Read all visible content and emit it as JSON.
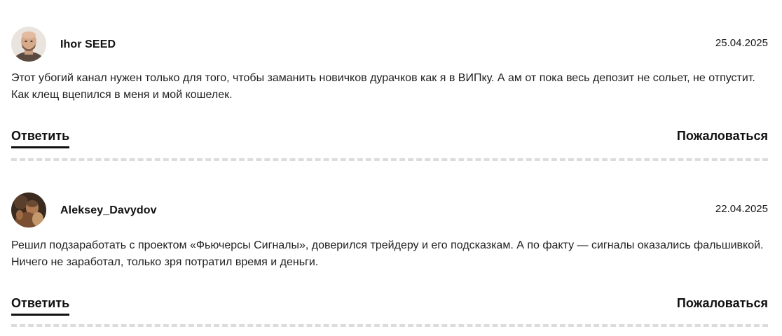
{
  "comments": [
    {
      "author": "Ihor SEED",
      "date": "25.04.2025",
      "text": "Этот убогий канал нужен только для того, чтобы заманить новичков дурачков как я в ВИПку. А ам от пока весь депозит не сольет, не отпустит. Как клещ вцепился в меня и мой кошелек.",
      "reply_label": "Ответить",
      "report_label": "Пожаловаться",
      "avatar_icon": "user-photo-bald-man"
    },
    {
      "author": "Aleksey_Davydov",
      "date": "22.04.2025",
      "text": "Решил подзаработать с проектом «Фьючерсы Сигналы», доверился трейдеру и его подсказкам. А по факту — сигналы оказались фальшивкой. Ничего не заработал, только зря потратил время и деньги.",
      "reply_label": "Ответить",
      "report_label": "Пожаловаться",
      "avatar_icon": "user-photo-painting"
    }
  ],
  "colors": {
    "text": "#1a1a1a",
    "divider": "#dcdcdc",
    "underline": "#111111"
  }
}
